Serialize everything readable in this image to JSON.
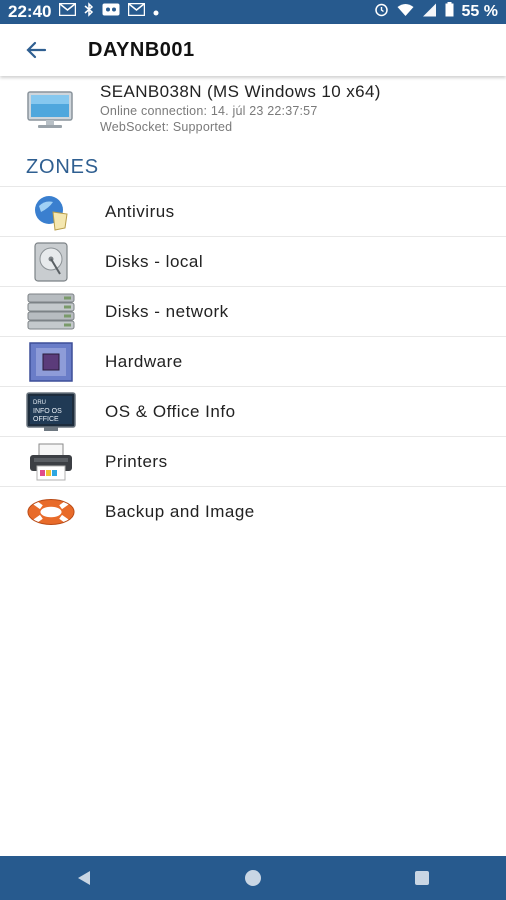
{
  "status_bar": {
    "time": "22:40",
    "battery": "55 %",
    "icons": [
      "gmail-icon",
      "bluetooth-icon",
      "voicemail-icon",
      "gmail-icon",
      "dot-icon",
      "alarm-icon",
      "wifi-icon",
      "signal-icon",
      "battery-icon"
    ]
  },
  "app_bar": {
    "title": "DAYNB001",
    "back_icon": "arrow-back-icon"
  },
  "device": {
    "name": "SEANB038N (MS Windows 10 x64)",
    "connection": "Online connection: 14. júl 23 22:37:57",
    "websocket": "WebSocket: Supported",
    "icon": "monitor-icon"
  },
  "zones": {
    "heading": "ZONES",
    "items": [
      {
        "label": "Antivirus",
        "icon": "antivirus-icon"
      },
      {
        "label": "Disks - local",
        "icon": "hard-disk-icon"
      },
      {
        "label": "Disks - network",
        "icon": "network-disks-icon"
      },
      {
        "label": "Hardware",
        "icon": "cpu-chip-icon"
      },
      {
        "label": "OS & Office Info",
        "icon": "os-info-icon",
        "icon_text": "DRU\nINFO OS\nOFFICE"
      },
      {
        "label": "Printers",
        "icon": "printer-icon"
      },
      {
        "label": "Backup and Image",
        "icon": "lifebuoy-icon"
      }
    ]
  },
  "colors": {
    "primary": "#275a8e",
    "heading": "#2f5f91"
  },
  "nav_bar": {
    "icons": [
      "nav-back-icon",
      "nav-home-icon",
      "nav-recents-icon"
    ]
  }
}
